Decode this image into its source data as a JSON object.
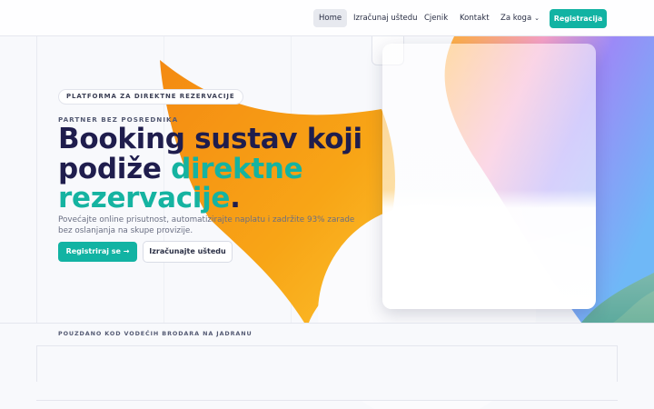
{
  "nav": {
    "items": [
      {
        "label": "Home",
        "active": true
      },
      {
        "label": "Izračunaj uštedu",
        "active": false
      },
      {
        "label": "Cjenik",
        "active": false
      },
      {
        "label": "Kontakt",
        "active": false
      },
      {
        "label": "Za koga",
        "active": false,
        "dropdown": true
      }
    ],
    "dropdown_icon": "chevron-down-icon",
    "cta_label": "Registracija"
  },
  "hero": {
    "pill": "PLATFORMA ZA DIREKTNE REZERVACIJE",
    "eyebrow": "PARTNER BEZ POSREDNIKA",
    "headline_part1": "Booking sustav koji podiže ",
    "headline_accent": "direktne rezervacije",
    "headline_end": ".",
    "subtitle": "Povećajte online prisutnost, automatizirajte naplatu i zadržite 93% zarade bez oslanjanja na skupe provizije.",
    "primary_button": "Registriraj se →",
    "secondary_button": "Izračunajte uštedu"
  },
  "trusted": {
    "title": "POUZDANO KOD VODEĆIH BRODARA NA JADRANU"
  },
  "colors": {
    "brand": "#12b3a3",
    "accent_text": "#15b3a1",
    "heading": "#1f1d4d",
    "orange": "#f7a21a",
    "purple": "#8b7cf6"
  }
}
